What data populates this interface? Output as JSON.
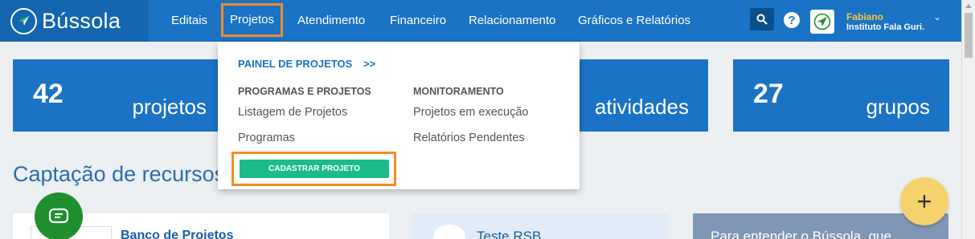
{
  "brand": {
    "name": "Bússola"
  },
  "nav": {
    "items": [
      {
        "label": "Editais"
      },
      {
        "label": "Projetos"
      },
      {
        "label": "Atendimento"
      },
      {
        "label": "Financeiro"
      },
      {
        "label": "Relacionamento"
      },
      {
        "label": "Gráficos e Relatórios"
      }
    ]
  },
  "user": {
    "name": "Fabiano",
    "org": "Instituto Fala Guri."
  },
  "stats": [
    {
      "number": "42",
      "label": "projetos"
    },
    {
      "number": "",
      "label": "atividades"
    },
    {
      "number": "27",
      "label": "grupos"
    }
  ],
  "section": {
    "title": "Captação de recursos"
  },
  "cards": [
    {
      "title": "Banco de Projetos"
    },
    {
      "title": "Teste RSB"
    },
    {
      "title": "Para entender o Bússola, que"
    }
  ],
  "dropdown": {
    "panel_label": "PAINEL DE PROJETOS",
    "panel_arrow": ">>",
    "col1_heading": "PROGRAMAS E PROJETOS",
    "col1_links": [
      "Listagem de Projetos",
      "Programas"
    ],
    "col2_heading": "MONITORAMENTO",
    "col2_links": [
      "Projetos em execução",
      "Relatórios Pendentes"
    ],
    "cta_label": "CADASTRAR PROJETO"
  },
  "colors": {
    "nav_bg": "#1a73c4",
    "highlight": "#f28c28",
    "cta": "#1bbc8c",
    "fab": "#f5d36c",
    "chat": "#1f8f2e"
  },
  "icons": [
    "search-icon",
    "help-icon",
    "compass-icon",
    "chevron-down-icon",
    "chat-icon",
    "plus-icon"
  ]
}
